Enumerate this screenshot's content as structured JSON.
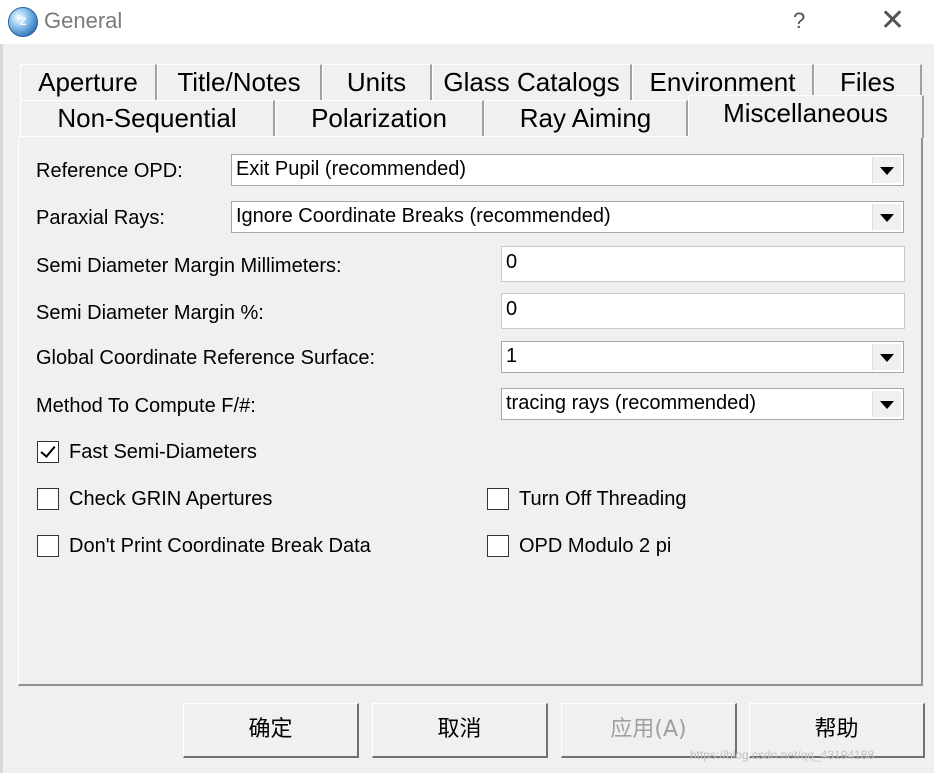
{
  "window": {
    "title": "General",
    "app_icon_text": "Z",
    "help_glyph": "?",
    "close_glyph": "✕"
  },
  "tabs": {
    "row1": [
      "Aperture",
      "Title/Notes",
      "Units",
      "Glass Catalogs",
      "Environment",
      "Files"
    ],
    "row2": [
      "Non-Sequential",
      "Polarization",
      "Ray Aiming",
      "Miscellaneous"
    ],
    "active": "Miscellaneous"
  },
  "fields": {
    "reference_opd": {
      "label": "Reference OPD:",
      "value": "Exit Pupil (recommended)"
    },
    "paraxial_rays": {
      "label": "Paraxial Rays:",
      "value": "Ignore Coordinate Breaks (recommended)"
    },
    "semi_diameter_mm": {
      "label": "Semi Diameter Margin Millimeters:",
      "value": "0"
    },
    "semi_diameter_pct": {
      "label": "Semi Diameter Margin %:",
      "value": "0"
    },
    "global_coord_ref": {
      "label": "Global Coordinate Reference Surface:",
      "value": "1"
    },
    "method_fnum": {
      "label": "Method To Compute F/#:",
      "value": "tracing rays (recommended)"
    }
  },
  "checkboxes": {
    "fast_semi_diameters": {
      "label": "Fast Semi-Diameters",
      "checked": true
    },
    "check_grin": {
      "label": "Check GRIN Apertures",
      "checked": false
    },
    "turn_off_threading": {
      "label": "Turn Off Threading",
      "checked": false
    },
    "dont_print_cb": {
      "label": "Don't Print Coordinate Break Data",
      "checked": false
    },
    "opd_modulo": {
      "label": "OPD Modulo 2 pi",
      "checked": false
    }
  },
  "buttons": {
    "ok": "确定",
    "cancel": "取消",
    "apply": "应用(A)",
    "help": "帮助"
  },
  "watermark": "https://blog.csdn.net/qq_43194188"
}
